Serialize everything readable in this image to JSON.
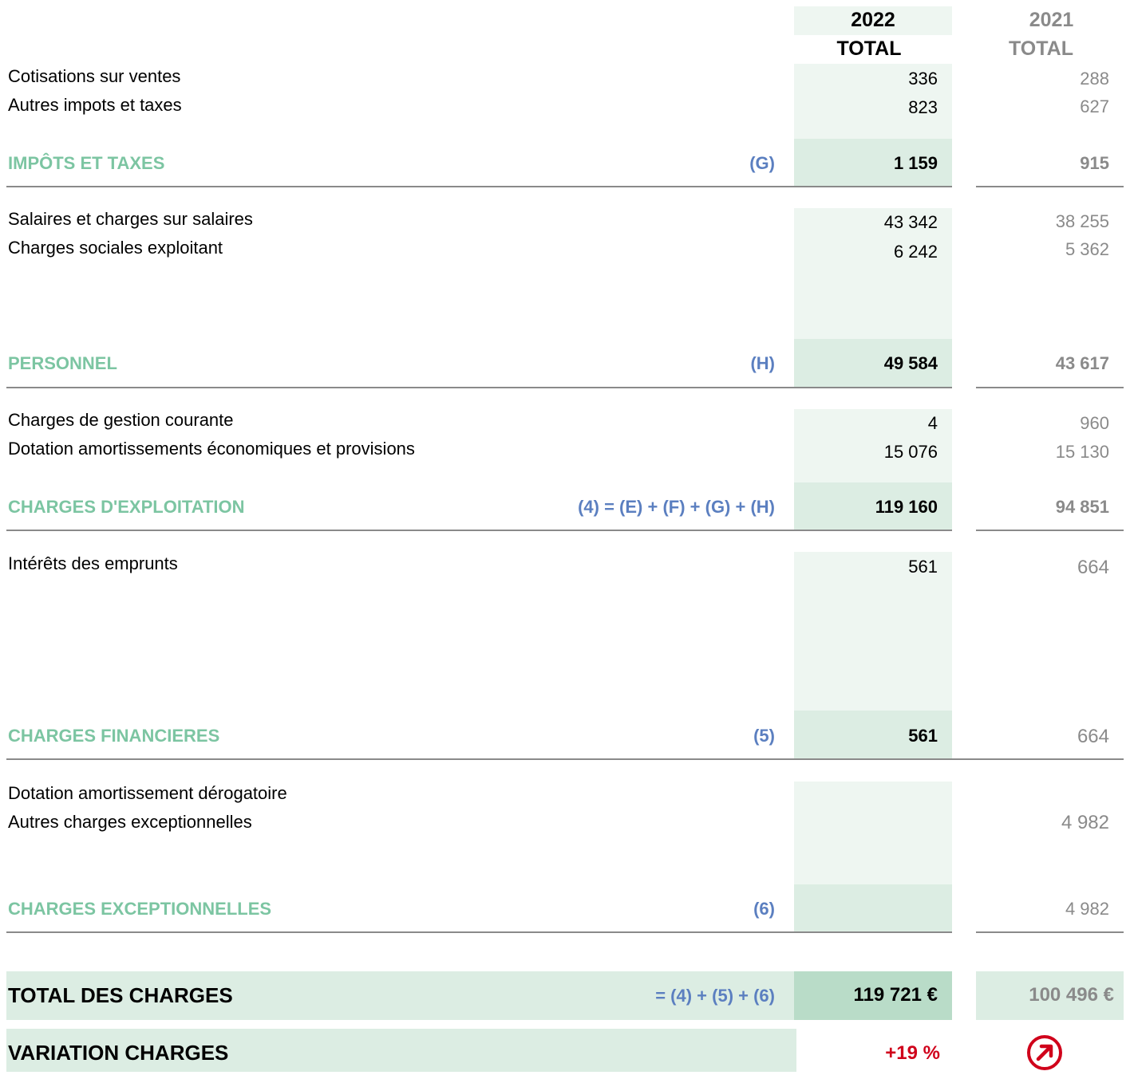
{
  "header": {
    "year_2022": "2022",
    "total_2022": "TOTAL",
    "year_2021": "2021",
    "total_2021": "TOTAL"
  },
  "sections": {
    "impots": {
      "rows": [
        {
          "label": "Cotisations sur ventes",
          "v2022": "336",
          "v2021": "288"
        },
        {
          "label": "Autres impots et taxes",
          "v2022": "823",
          "v2021": "627"
        }
      ],
      "title": "IMPÔTS ET TAXES",
      "formula": "(G)",
      "total_2022": "1 159",
      "total_2021": "915"
    },
    "personnel": {
      "rows": [
        {
          "label": "Salaires et charges sur salaires",
          "v2022": "43 342",
          "v2021": "38 255"
        },
        {
          "label": "Charges sociales exploitant",
          "v2022": "6 242",
          "v2021": "5 362"
        }
      ],
      "title": "PERSONNEL",
      "formula": "(H)",
      "total_2022": "49 584",
      "total_2021": "43 617"
    },
    "exploitation": {
      "rows": [
        {
          "label": "Charges de gestion courante",
          "v2022": "4",
          "v2021": "960"
        },
        {
          "label": "Dotation amortissements économiques et provisions",
          "v2022": "15 076",
          "v2021": "15 130"
        }
      ],
      "title": "CHARGES D'EXPLOITATION",
      "formula": "(4) = (E) + (F) + (G) + (H)",
      "total_2022": "119 160",
      "total_2021": "94 851"
    },
    "financieres": {
      "rows": [
        {
          "label": "Intérêts des emprunts",
          "v2022": "561",
          "v2021": "664"
        }
      ],
      "title": "CHARGES FINANCIERES",
      "formula": "(5)",
      "total_2022": "561",
      "total_2021": "664"
    },
    "exceptionnelles": {
      "rows": [
        {
          "label": "Dotation amortissement dérogatoire",
          "v2022": "",
          "v2021": ""
        },
        {
          "label": "Autres charges exceptionnelles",
          "v2022": "",
          "v2021": "4 982"
        }
      ],
      "title": "CHARGES EXCEPTIONNELLES",
      "formula": "(6)",
      "total_2022": "",
      "total_2021": "4 982"
    }
  },
  "total": {
    "label": "TOTAL DES CHARGES",
    "formula": "= (4) + (5) + (6)",
    "v2022": "119 721 €",
    "v2021": "100 496 €"
  },
  "variation": {
    "label": "VARIATION CHARGES",
    "value": "+19 %",
    "trend_icon": "arrow-up-right-circle-icon"
  },
  "colors": {
    "section_title": "#7cc5a2",
    "formula": "#5b7fc0",
    "variation": "#d0021b",
    "prior_year": "#8a8a8a"
  }
}
